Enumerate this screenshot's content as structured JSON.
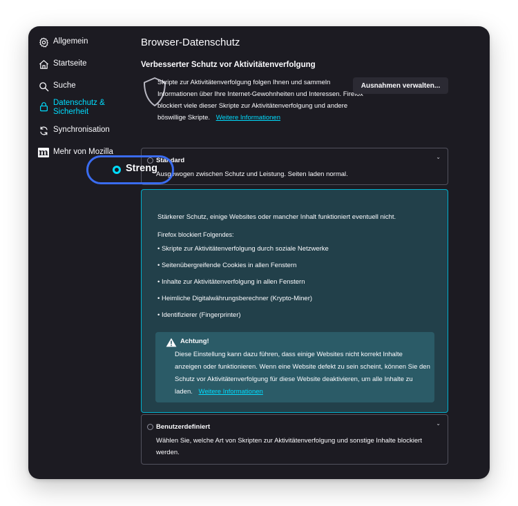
{
  "sidebar": {
    "items": [
      {
        "label": "Allgemein",
        "icon": "gear-icon"
      },
      {
        "label": "Startseite",
        "icon": "home-icon"
      },
      {
        "label": "Suche",
        "icon": "search-icon"
      },
      {
        "label": "Datenschutz & Sicherheit",
        "icon": "lock-icon"
      },
      {
        "label": "Synchronisation",
        "icon": "sync-icon"
      },
      {
        "label": "Mehr von Mozilla",
        "icon": "mozilla-icon"
      }
    ]
  },
  "main": {
    "title": "Browser-Datenschutz",
    "section_title": "Verbesserter Schutz vor Aktivitätenverfolgung",
    "description": "Skripte zur Aktivitätenverfolgung folgen Ihnen und sammeln Informationen über Ihre Internet-Gewohnheiten und Interessen. Firefox blockiert viele dieser Skripte zur Aktivitätenverfolgung und andere böswillige Skripte.",
    "description_link": "Weitere Informationen",
    "exceptions_button": "Ausnahmen verwalten...",
    "standard": {
      "label": "Standard",
      "subtitle": "Ausgewogen zwischen Schutz und Leistung. Seiten laden normal."
    },
    "strict": {
      "label": "Streng",
      "subtitle": "Stärkerer Schutz, einige Websites oder mancher Inhalt funktioniert eventuell nicht.",
      "blocks_intro": "Firefox blockiert Folgendes:",
      "blocks": [
        "Skripte zur Aktivitätenverfolgung durch soziale Netzwerke",
        "Seitenübergreifende Cookies in allen Fenstern",
        "Inhalte zur Aktivitätenverfolgung in allen Fenstern",
        "Heimliche Digitalwährungsberechner (Krypto-Miner)",
        "Identifizierer (Fingerprinter)"
      ],
      "warning_title": "Achtung!",
      "warning_text": "Diese Einstellung kann dazu führen, dass einige Websites nicht korrekt Inhalte anzeigen oder funktionieren. Wenn eine Website defekt zu sein scheint, können Sie den Schutz vor Aktivitätenverfolgung für diese Website deaktivieren, um alle Inhalte zu laden.",
      "warning_link": "Weitere Informationen"
    },
    "custom": {
      "label": "Benutzerdefiniert",
      "subtitle": "Wählen Sie, welche Art von Skripten zur Aktivitätenverfolgung und sonstige Inhalte blockiert werden."
    }
  },
  "colors": {
    "accent": "#00ddff",
    "background": "#1c1b22",
    "focus_ring": "#3a6cf0",
    "strict_card": "#22404a",
    "warning_box": "#2b5b67"
  }
}
